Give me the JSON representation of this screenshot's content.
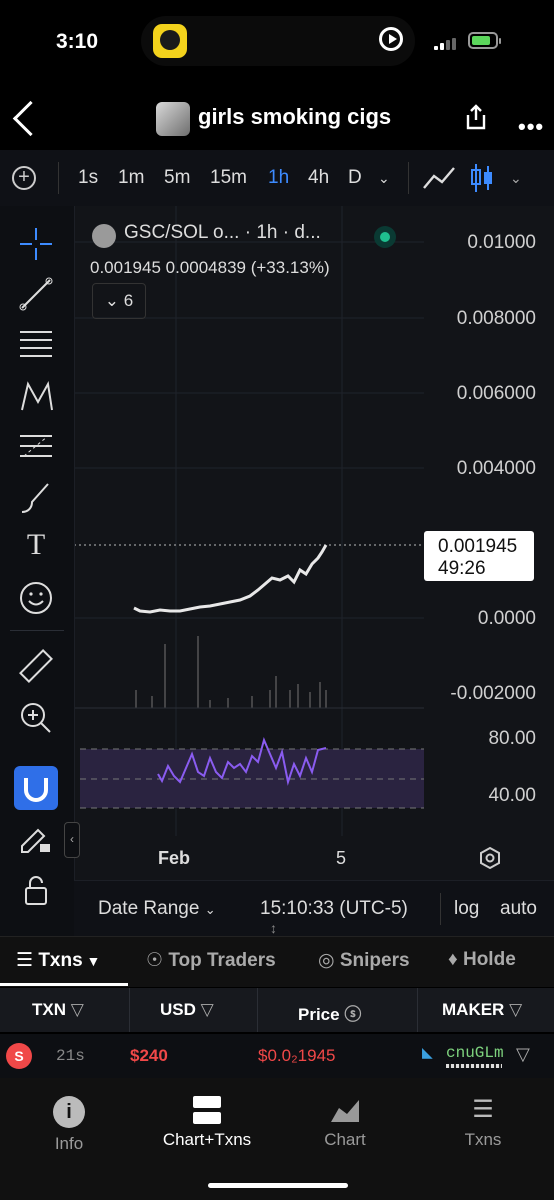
{
  "status": {
    "time": "3:10"
  },
  "header": {
    "title": "girls smoking cigs"
  },
  "toolbar": {
    "timeframes": [
      "1s",
      "1m",
      "5m",
      "15m",
      "1h",
      "4h",
      "D"
    ],
    "selected": "1h"
  },
  "chart": {
    "legend_title": "GSC/SOL o... · 1h · d...",
    "legend_values": "0.001945  0.0004839 (+33.13%)",
    "indicators_count": "6",
    "price_axis": [
      "0.01000",
      "0.008000",
      "0.006000",
      "0.004000",
      "0.0000",
      "-0.002000"
    ],
    "current_price": "0.001945",
    "countdown": "49:26",
    "rsi_axis": [
      "80.00",
      "40.00"
    ],
    "x_labels": [
      "Feb",
      "5"
    ],
    "date_range": "Date Range",
    "clock": "15:10:33 (UTC-5)",
    "log_label": "log",
    "auto_label": "auto"
  },
  "tabs": {
    "txns": "Txns",
    "top_traders": "Top Traders",
    "snipers": "Snipers",
    "holders": "Holde"
  },
  "table": {
    "headers": [
      "TXN",
      "USD",
      "Price",
      "MAKER"
    ],
    "rows": [
      {
        "type": "S",
        "age": "21s",
        "usd": "$240",
        "price": "$0.0₂1945",
        "maker": "cnuGLm"
      }
    ]
  },
  "bottom_nav": {
    "items": [
      "Info",
      "Chart+Txns",
      "Chart",
      "Txns"
    ],
    "active": "Chart+Txns"
  },
  "colors": {
    "accent": "#3d8bff",
    "sell": "#f04848",
    "background": "#121418",
    "rsi_band": "#2a2340",
    "rsi_line": "#8a5cf0"
  }
}
